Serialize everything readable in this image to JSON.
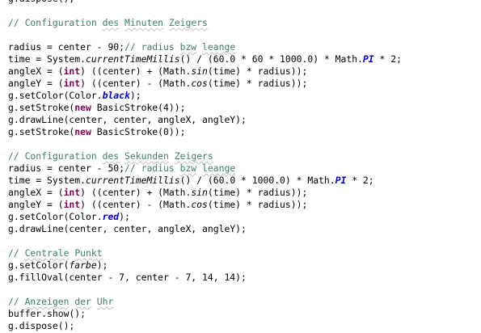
{
  "editor": {
    "language": "Java",
    "colors": {
      "comment": "#3f7f5f",
      "keyword": "#7f0055",
      "static_field": "#0000c0",
      "text": "#000000",
      "spell_underline": "#c0c0c0"
    },
    "lines": [
      [
        {
          "t": "g.dispose();"
        }
      ],
      [],
      [
        {
          "t": "// Configuration ",
          "s": "comment"
        },
        {
          "t": "des",
          "s": "comment spell"
        },
        {
          "t": " ",
          "s": "comment"
        },
        {
          "t": "Minuten",
          "s": "comment spell"
        },
        {
          "t": " ",
          "s": "comment"
        },
        {
          "t": "Zeigers",
          "s": "comment spell"
        }
      ],
      [],
      [
        {
          "t": "radius = center - 90;"
        },
        {
          "t": "// radius ",
          "s": "comment"
        },
        {
          "t": "bzw",
          "s": "comment spell"
        },
        {
          "t": " ",
          "s": "comment"
        },
        {
          "t": "leange",
          "s": "comment spell"
        }
      ],
      [
        {
          "t": "time = System."
        },
        {
          "t": "currentTimeMillis",
          "s": "italic"
        },
        {
          "t": "() / (60.0 * 60 * 1000.0) * Math."
        },
        {
          "t": "PI",
          "s": "field"
        },
        {
          "t": " * 2;"
        }
      ],
      [
        {
          "t": "angleX = ("
        },
        {
          "t": "int",
          "s": "keyword"
        },
        {
          "t": ") ((center) + (Math."
        },
        {
          "t": "sin",
          "s": "italic"
        },
        {
          "t": "(time) * radius));"
        }
      ],
      [
        {
          "t": "angleY = ("
        },
        {
          "t": "int",
          "s": "keyword"
        },
        {
          "t": ") ((center) - (Math."
        },
        {
          "t": "cos",
          "s": "italic"
        },
        {
          "t": "(time) * radius));"
        }
      ],
      [
        {
          "t": "g.setColor(Color."
        },
        {
          "t": "black",
          "s": "field"
        },
        {
          "t": ");"
        }
      ],
      [
        {
          "t": "g.setStroke("
        },
        {
          "t": "new",
          "s": "keyword"
        },
        {
          "t": " BasicStroke(4));"
        }
      ],
      [
        {
          "t": "g.drawLine(center, center, angleX, angleY);"
        }
      ],
      [
        {
          "t": "g.setStroke("
        },
        {
          "t": "new",
          "s": "keyword"
        },
        {
          "t": " BasicStroke(0));"
        }
      ],
      [],
      [
        {
          "t": "// Configuration ",
          "s": "comment"
        },
        {
          "t": "des",
          "s": "comment spell"
        },
        {
          "t": " ",
          "s": "comment"
        },
        {
          "t": "Sekunden",
          "s": "comment spell"
        },
        {
          "t": " ",
          "s": "comment"
        },
        {
          "t": "Zeigers",
          "s": "comment spell"
        }
      ],
      [
        {
          "t": "radius = center - 50;"
        },
        {
          "t": "// radius ",
          "s": "comment"
        },
        {
          "t": "bzw",
          "s": "comment spell"
        },
        {
          "t": " ",
          "s": "comment"
        },
        {
          "t": "leange",
          "s": "comment spell"
        }
      ],
      [
        {
          "t": "time = System."
        },
        {
          "t": "currentTimeMillis",
          "s": "italic"
        },
        {
          "t": "() / (60.0 * 1000.0) * Math."
        },
        {
          "t": "PI",
          "s": "field"
        },
        {
          "t": " * 2;"
        }
      ],
      [
        {
          "t": "angleX = ("
        },
        {
          "t": "int",
          "s": "keyword"
        },
        {
          "t": ") ((center) + (Math."
        },
        {
          "t": "sin",
          "s": "italic"
        },
        {
          "t": "(time) * radius));"
        }
      ],
      [
        {
          "t": "angleY = ("
        },
        {
          "t": "int",
          "s": "keyword"
        },
        {
          "t": ") ((center) - (Math."
        },
        {
          "t": "cos",
          "s": "italic"
        },
        {
          "t": "(time) * radius));"
        }
      ],
      [
        {
          "t": "g.setColor(Color."
        },
        {
          "t": "red",
          "s": "field"
        },
        {
          "t": ");"
        }
      ],
      [
        {
          "t": "g.drawLine(center, center, angleX, angleY);"
        }
      ],
      [],
      [
        {
          "t": "// ",
          "s": "comment"
        },
        {
          "t": "Centrale",
          "s": "comment spell"
        },
        {
          "t": " ",
          "s": "comment"
        },
        {
          "t": "Punkt",
          "s": "comment spell"
        }
      ],
      [
        {
          "t": "g.setColor("
        },
        {
          "t": "farbe",
          "s": "italic"
        },
        {
          "t": ");"
        }
      ],
      [
        {
          "t": "g.fillOval(center - 7, center - 7, 14, 14);"
        }
      ],
      [],
      [
        {
          "t": "// ",
          "s": "comment"
        },
        {
          "t": "Anzeigen",
          "s": "comment spell"
        },
        {
          "t": " ",
          "s": "comment"
        },
        {
          "t": "der",
          "s": "comment spell"
        },
        {
          "t": " ",
          "s": "comment"
        },
        {
          "t": "Uhr",
          "s": "comment spell"
        }
      ],
      [
        {
          "t": "buffer.show();"
        }
      ],
      [
        {
          "t": "g.dispose();"
        }
      ]
    ]
  }
}
